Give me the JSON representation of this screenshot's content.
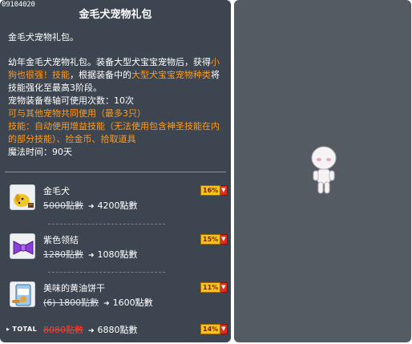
{
  "item_id": "09104020",
  "title": "金毛犬宠物礼包",
  "description": {
    "intro": "金毛犬宠物礼包。",
    "p1_a": "幼年金毛犬宠物礼包。装备大型犬宝宝宠物后，获得",
    "p1_highlight1": "小狗也很强！技能",
    "p1_b": "，根据装备中的",
    "p1_highlight2": "大型犬宝宝宠物种类",
    "p1_c": "将技能强化至最高3阶段。",
    "scroll_limit": "宠物装备卷轴可使用次数：10次",
    "shared_use": "可与其他宠物共同使用（最多3只）",
    "skill": "技能：自动使用增益技能（无法使用包含神圣技能在内的部分技能）、捡金币、拾取道具",
    "magic_time": "魔法时间：90天"
  },
  "items": [
    {
      "name": "金毛犬",
      "old_price": "5000點數",
      "new_price": "4200點數",
      "discount": "16%",
      "icon": "golden-dog-icon"
    },
    {
      "name": "紫色领结",
      "old_price": "1280點數",
      "new_price": "1080點數",
      "discount": "15%",
      "icon": "purple-bowtie-icon"
    },
    {
      "name": "美味的黄油饼干",
      "old_price": "(6) 1800點數",
      "new_price": "1600點數",
      "discount": "11%",
      "icon": "butter-biscuit-icon"
    }
  ],
  "total": {
    "label": "TOTAL",
    "old_price": "8080點數",
    "new_price": "6880點數",
    "discount": "14%"
  },
  "colors": {
    "panel": "#3d4550",
    "preview": "#555b62",
    "highlight": "#ff9b1f",
    "discount_badge": "#f6c41a",
    "discount_arrow": "#e22b18"
  },
  "preview_icon": "character-avatar-icon"
}
